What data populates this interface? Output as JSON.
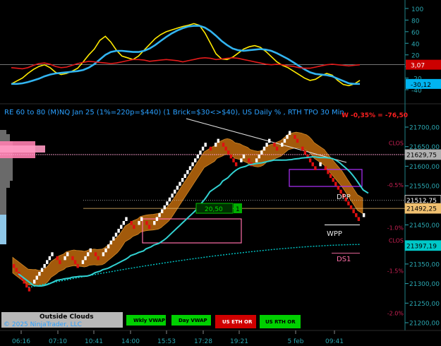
{
  "chart_data": [
    {
      "type": "line",
      "panel": "oscillator",
      "ylim": [
        -50,
        100
      ],
      "y_ticks": [
        "100",
        "80",
        "60",
        "40",
        "20",
        "0",
        "-20",
        "-40"
      ],
      "value_labels": [
        {
          "text": "3,07",
          "color": "#cc0000",
          "text_color": "#ffffff"
        },
        {
          "text": "-30,12",
          "color": "#00b4f0",
          "text_color": "#000000"
        }
      ],
      "series": [
        {
          "color": "#ffea00",
          "values": [
            -30,
            -25,
            -20,
            -12,
            -5,
            0,
            3,
            -2,
            -10,
            -14,
            -12,
            -8,
            -3,
            8,
            20,
            30,
            45,
            52,
            42,
            28,
            18,
            15,
            12,
            18,
            28,
            38,
            48,
            55,
            60,
            63,
            66,
            69,
            71,
            74,
            71,
            58,
            40,
            22,
            13,
            12,
            16,
            23,
            30,
            34,
            36,
            33,
            26,
            17,
            8,
            2,
            -2,
            -8,
            -14,
            -20,
            -24,
            -22,
            -16,
            -12,
            -15,
            -24,
            -31,
            -33,
            -30,
            -24
          ]
        },
        {
          "color": "#32b4f0",
          "values": [
            -30,
            -30,
            -29,
            -27,
            -24,
            -21,
            -17,
            -14,
            -12,
            -11,
            -10,
            -9,
            -8,
            -6,
            -2,
            4,
            12,
            20,
            25,
            27,
            27,
            26,
            25,
            25,
            27,
            31,
            37,
            44,
            51,
            57,
            62,
            66,
            69,
            70,
            70,
            67,
            61,
            53,
            44,
            37,
            31,
            28,
            27,
            28,
            29,
            30,
            29,
            27,
            23,
            18,
            13,
            7,
            1,
            -5,
            -10,
            -13,
            -14,
            -15,
            -17,
            -21,
            -25,
            -29,
            -30,
            -30
          ]
        },
        {
          "color": "#e61b1b",
          "values": [
            -2,
            -3,
            -4,
            -2,
            2,
            5,
            6,
            4,
            0,
            -2,
            -1,
            2,
            5,
            7,
            9,
            8,
            7,
            6,
            5,
            6,
            8,
            10,
            12,
            12,
            11,
            9,
            10,
            11,
            12,
            11,
            10,
            8,
            10,
            12,
            14,
            15,
            14,
            12,
            13,
            14,
            15,
            14,
            12,
            10,
            8,
            6,
            4,
            3,
            4,
            3,
            1,
            0,
            -2,
            -3,
            -3,
            -1,
            1,
            3,
            4,
            3,
            2,
            1,
            2,
            3
          ]
        }
      ]
    },
    {
      "type": "candlestick",
      "panel": "price",
      "ylim": [
        21195,
        21740
      ],
      "y_ticks": [
        "21700,00",
        "21650,00",
        "21600,00",
        "21550,00",
        "21500,00",
        "21450,00",
        "21400,00",
        "21350,00",
        "21300,00",
        "21250,00",
        "21200,00"
      ],
      "brick_size": 10,
      "bricks": [
        {
          "i": 0,
          "o": 21350,
          "c": 21340
        },
        {
          "i": 1,
          "o": 21340,
          "c": 21330
        },
        {
          "i": 2,
          "o": 21330,
          "c": 21320
        },
        {
          "i": 3,
          "o": 21320,
          "c": 21310
        },
        {
          "i": 4,
          "o": 21310,
          "c": 21300
        },
        {
          "i": 5,
          "o": 21300,
          "c": 21290
        },
        {
          "i": 6,
          "o": 21290,
          "c": 21280
        },
        {
          "i": 8,
          "o": 21300,
          "c": 21310
        },
        {
          "i": 9,
          "o": 21310,
          "c": 21320
        },
        {
          "i": 10,
          "o": 21320,
          "c": 21330
        },
        {
          "i": 11,
          "o": 21330,
          "c": 21340
        },
        {
          "i": 12,
          "o": 21340,
          "c": 21350
        },
        {
          "i": 13,
          "o": 21350,
          "c": 21360
        },
        {
          "i": 14,
          "o": 21360,
          "c": 21370
        },
        {
          "i": 15,
          "o": 21370,
          "c": 21380
        },
        {
          "i": 17,
          "o": 21370,
          "c": 21360
        },
        {
          "i": 18,
          "o": 21360,
          "c": 21350
        },
        {
          "i": 20,
          "o": 21360,
          "c": 21370
        },
        {
          "i": 21,
          "o": 21370,
          "c": 21380
        },
        {
          "i": 23,
          "o": 21370,
          "c": 21360
        },
        {
          "i": 24,
          "o": 21360,
          "c": 21350
        },
        {
          "i": 25,
          "o": 21350,
          "c": 21340
        },
        {
          "i": 27,
          "o": 21350,
          "c": 21360
        },
        {
          "i": 28,
          "o": 21360,
          "c": 21370
        },
        {
          "i": 29,
          "o": 21370,
          "c": 21380
        },
        {
          "i": 30,
          "o": 21380,
          "c": 21390
        },
        {
          "i": 32,
          "o": 21380,
          "c": 21370
        },
        {
          "i": 33,
          "o": 21370,
          "c": 21360
        },
        {
          "i": 35,
          "o": 21370,
          "c": 21380
        },
        {
          "i": 36,
          "o": 21380,
          "c": 21390
        },
        {
          "i": 37,
          "o": 21390,
          "c": 21400
        },
        {
          "i": 38,
          "o": 21400,
          "c": 21410
        },
        {
          "i": 39,
          "o": 21410,
          "c": 21420
        },
        {
          "i": 40,
          "o": 21420,
          "c": 21430
        },
        {
          "i": 41,
          "o": 21430,
          "c": 21440
        },
        {
          "i": 42,
          "o": 21440,
          "c": 21450
        },
        {
          "i": 43,
          "o": 21450,
          "c": 21460
        },
        {
          "i": 44,
          "o": 21460,
          "c": 21470
        },
        {
          "i": 46,
          "o": 21460,
          "c": 21450
        },
        {
          "i": 47,
          "o": 21450,
          "c": 21440
        },
        {
          "i": 49,
          "o": 21450,
          "c": 21460
        },
        {
          "i": 50,
          "o": 21460,
          "c": 21470
        },
        {
          "i": 52,
          "o": 21460,
          "c": 21450
        },
        {
          "i": 53,
          "o": 21450,
          "c": 21440
        },
        {
          "i": 55,
          "o": 21450,
          "c": 21460
        },
        {
          "i": 56,
          "o": 21460,
          "c": 21470
        },
        {
          "i": 57,
          "o": 21470,
          "c": 21480
        },
        {
          "i": 58,
          "o": 21480,
          "c": 21490
        },
        {
          "i": 59,
          "o": 21490,
          "c": 21500
        },
        {
          "i": 60,
          "o": 21500,
          "c": 21510
        },
        {
          "i": 61,
          "o": 21510,
          "c": 21520
        },
        {
          "i": 62,
          "o": 21520,
          "c": 21530
        },
        {
          "i": 63,
          "o": 21530,
          "c": 21540
        },
        {
          "i": 64,
          "o": 21540,
          "c": 21550
        },
        {
          "i": 65,
          "o": 21550,
          "c": 21560
        },
        {
          "i": 66,
          "o": 21560,
          "c": 21570
        },
        {
          "i": 67,
          "o": 21570,
          "c": 21580
        },
        {
          "i": 68,
          "o": 21580,
          "c": 21590
        },
        {
          "i": 69,
          "o": 21590,
          "c": 21600
        },
        {
          "i": 70,
          "o": 21600,
          "c": 21610
        },
        {
          "i": 71,
          "o": 21610,
          "c": 21620
        },
        {
          "i": 72,
          "o": 21620,
          "c": 21630
        },
        {
          "i": 73,
          "o": 21630,
          "c": 21640
        },
        {
          "i": 74,
          "o": 21640,
          "c": 21650
        },
        {
          "i": 75,
          "o": 21650,
          "c": 21660
        },
        {
          "i": 77,
          "o": 21650,
          "c": 21640
        },
        {
          "i": 79,
          "o": 21650,
          "c": 21660
        },
        {
          "i": 80,
          "o": 21660,
          "c": 21670
        },
        {
          "i": 82,
          "o": 21660,
          "c": 21650
        },
        {
          "i": 83,
          "o": 21650,
          "c": 21640
        },
        {
          "i": 84,
          "o": 21640,
          "c": 21630
        },
        {
          "i": 85,
          "o": 21630,
          "c": 21620
        },
        {
          "i": 86,
          "o": 21620,
          "c": 21610
        },
        {
          "i": 87,
          "o": 21610,
          "c": 21600
        },
        {
          "i": 89,
          "o": 21610,
          "c": 21620
        },
        {
          "i": 90,
          "o": 21620,
          "c": 21630
        },
        {
          "i": 92,
          "o": 21620,
          "c": 21610
        },
        {
          "i": 93,
          "o": 21610,
          "c": 21600
        },
        {
          "i": 95,
          "o": 21610,
          "c": 21620
        },
        {
          "i": 96,
          "o": 21620,
          "c": 21630
        },
        {
          "i": 97,
          "o": 21630,
          "c": 21640
        },
        {
          "i": 98,
          "o": 21640,
          "c": 21650
        },
        {
          "i": 99,
          "o": 21650,
          "c": 21660
        },
        {
          "i": 100,
          "o": 21660,
          "c": 21670
        },
        {
          "i": 102,
          "o": 21660,
          "c": 21650
        },
        {
          "i": 103,
          "o": 21650,
          "c": 21640
        },
        {
          "i": 105,
          "o": 21650,
          "c": 21660
        },
        {
          "i": 106,
          "o": 21660,
          "c": 21670
        },
        {
          "i": 107,
          "o": 21670,
          "c": 21680
        },
        {
          "i": 108,
          "o": 21680,
          "c": 21690
        },
        {
          "i": 110,
          "o": 21680,
          "c": 21670
        },
        {
          "i": 111,
          "o": 21670,
          "c": 21660
        },
        {
          "i": 113,
          "o": 21650,
          "c": 21640
        },
        {
          "i": 114,
          "o": 21640,
          "c": 21630
        },
        {
          "i": 115,
          "o": 21630,
          "c": 21620
        },
        {
          "i": 116,
          "o": 21620,
          "c": 21610
        },
        {
          "i": 117,
          "o": 21610,
          "c": 21600
        },
        {
          "i": 118,
          "o": 21600,
          "c": 21590
        },
        {
          "i": 120,
          "o": 21600,
          "c": 21610
        },
        {
          "i": 122,
          "o": 21600,
          "c": 21590
        },
        {
          "i": 123,
          "o": 21590,
          "c": 21580
        },
        {
          "i": 124,
          "o": 21580,
          "c": 21570
        },
        {
          "i": 125,
          "o": 21570,
          "c": 21560
        },
        {
          "i": 126,
          "o": 21560,
          "c": 21550
        },
        {
          "i": 127,
          "o": 21550,
          "c": 21540
        },
        {
          "i": 128,
          "o": 21540,
          "c": 21530
        },
        {
          "i": 129,
          "o": 21530,
          "c": 21520
        },
        {
          "i": 130,
          "o": 21520,
          "c": 21510
        },
        {
          "i": 131,
          "o": 21510,
          "c": 21500
        },
        {
          "i": 132,
          "o": 21500,
          "c": 21490
        },
        {
          "i": 133,
          "o": 21490,
          "c": 21480
        },
        {
          "i": 134,
          "o": 21480,
          "c": 21470
        },
        {
          "i": 135,
          "o": 21470,
          "c": 21460
        },
        {
          "i": 137,
          "o": 21470,
          "c": 21480
        }
      ]
    }
  ],
  "header": {
    "title": "RE 60 to 80 (M)NQ Jan 25 (1%=220p=$440) (1 Brick=$30<>$40), US Daily % , RTH TPO 30 Min",
    "title_color": "#2aa0ff",
    "stat": "W -0,35% = -76,50",
    "stat_color": "#ff2020"
  },
  "price_labels": [
    {
      "text": "21629,75",
      "price": 21629.75,
      "bg": "#b0b0b0",
      "fg": "#000000"
    },
    {
      "text": "21512,75",
      "price": 21512.75,
      "bg": "#000000",
      "fg": "#ffffff"
    },
    {
      "text": "21492,25",
      "price": 21492.25,
      "bg": "#f0c070",
      "fg": "#000000"
    },
    {
      "text": "21397,19",
      "price": 21397.19,
      "bg": "#00c8c8",
      "fg": "#000000"
    }
  ],
  "level_labels": [
    {
      "text": "CLOS",
      "price": 21659,
      "color": "#cc2255"
    },
    {
      "text": "CLOS",
      "price": 21410,
      "color": "#cc2255"
    },
    {
      "text": "-0.5%",
      "price": 21552,
      "color": "#cc2255"
    },
    {
      "text": "-1.0%",
      "price": 21443,
      "color": "#cc2255"
    },
    {
      "text": "-1.5%",
      "price": 21333,
      "color": "#cc2255"
    },
    {
      "text": "-2.0%",
      "price": 21224,
      "color": "#cc2255"
    }
  ],
  "annotations": {
    "dpp": "DPP",
    "wpp": "WPP",
    "ds1": "DS1",
    "box_value": "20,50",
    "box_marker": "1"
  },
  "time_axis": [
    "06:16",
    "07:10",
    "10:41",
    "14:00",
    "15:53",
    "17:28",
    "19:21",
    "5 feb",
    "09:41"
  ],
  "buttons": {
    "outside_clouds": "Outside Clouds",
    "copyright": "© 2025 NinjaTrader, LLC",
    "wkly_vwap": "Wkly VWAP",
    "day_vwap": "Day VWAP",
    "us_eth_or": "US ETH OR",
    "us_rth_or": "US RTH OR"
  },
  "colors": {
    "up_brick": "#ffffff",
    "down_brick": "#e01010",
    "cloud": "#b0620c",
    "cyan_line": "#32d2d2",
    "axis": "#2aa6b0",
    "green_button": "#00d000",
    "red_button": "#d00000"
  }
}
